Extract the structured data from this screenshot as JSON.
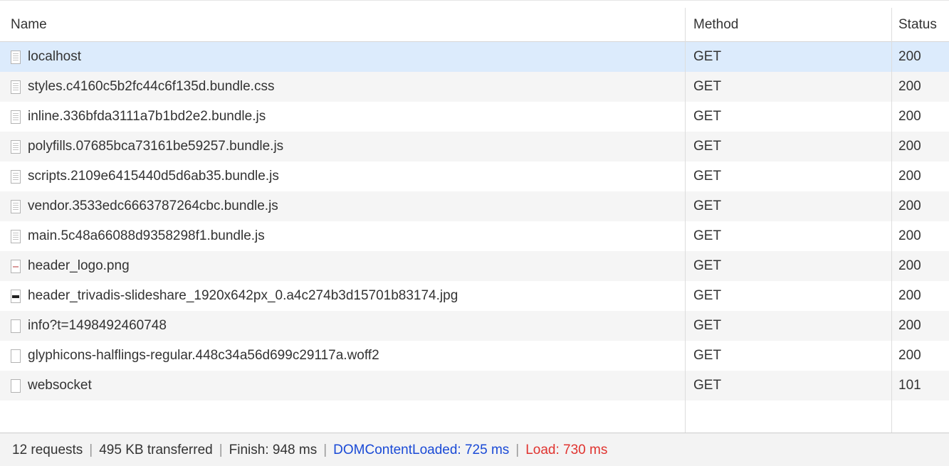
{
  "columns": {
    "name": "Name",
    "method": "Method",
    "status": "Status"
  },
  "requests": [
    {
      "name": "localhost",
      "method": "GET",
      "status": "200",
      "icon": "document-icon"
    },
    {
      "name": "styles.c4160c5b2fc44c6f135d.bundle.css",
      "method": "GET",
      "status": "200",
      "icon": "document-icon"
    },
    {
      "name": "inline.336bfda3111a7b1bd2e2.bundle.js",
      "method": "GET",
      "status": "200",
      "icon": "document-icon"
    },
    {
      "name": "polyfills.07685bca73161be59257.bundle.js",
      "method": "GET",
      "status": "200",
      "icon": "document-icon"
    },
    {
      "name": "scripts.2109e6415440d5d6ab35.bundle.js",
      "method": "GET",
      "status": "200",
      "icon": "document-icon"
    },
    {
      "name": "vendor.3533edc6663787264cbc.bundle.js",
      "method": "GET",
      "status": "200",
      "icon": "document-icon"
    },
    {
      "name": "main.5c48a66088d9358298f1.bundle.js",
      "method": "GET",
      "status": "200",
      "icon": "document-icon"
    },
    {
      "name": "header_logo.png",
      "method": "GET",
      "status": "200",
      "icon": "image-icon"
    },
    {
      "name": "header_trivadis-slideshare_1920x642px_0.a4c274b3d15701b83174.jpg",
      "method": "GET",
      "status": "200",
      "icon": "dark-image-icon"
    },
    {
      "name": "info?t=1498492460748",
      "method": "GET",
      "status": "200",
      "icon": "blank-file-icon"
    },
    {
      "name": "glyphicons-halflings-regular.448c34a56d699c29117a.woff2",
      "method": "GET",
      "status": "200",
      "icon": "blank-file-icon"
    },
    {
      "name": "websocket",
      "method": "GET",
      "status": "101",
      "icon": "blank-file-icon"
    }
  ],
  "selected_index": 0,
  "footer": {
    "requests": "12 requests",
    "transferred": "495 KB transferred",
    "finish": "Finish: 948 ms",
    "dom_content_loaded": "DOMContentLoaded: 725 ms",
    "load": "Load: 730 ms",
    "separator": "|"
  },
  "colors": {
    "selected_row": "#dcebfc",
    "alt_row": "#f5f5f5",
    "dom_content_loaded": "#1a4ad6",
    "load": "#e0332f"
  }
}
